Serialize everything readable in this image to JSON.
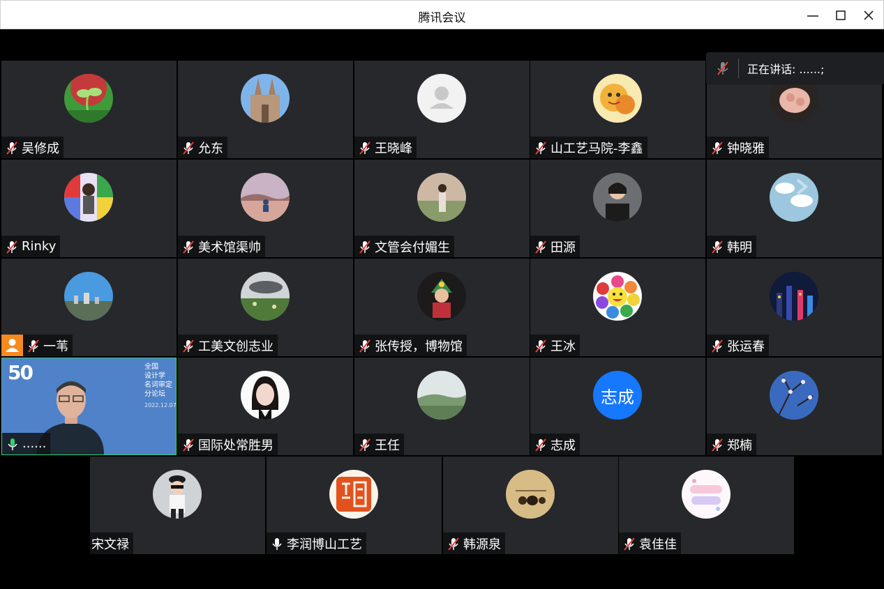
{
  "window": {
    "title": "腾讯会议"
  },
  "speaking": {
    "label": "正在讲话: ......;"
  },
  "participants": [
    {
      "name": "吴修成",
      "mic": "muted"
    },
    {
      "name": "允东",
      "mic": "muted"
    },
    {
      "name": "王晓峰",
      "mic": "muted"
    },
    {
      "name": "山工艺马院-李鑫",
      "mic": "muted"
    },
    {
      "name": "钟晓雅",
      "mic": "muted"
    },
    {
      "name": "Rinky",
      "mic": "muted"
    },
    {
      "name": "美术馆渠帅",
      "mic": "muted"
    },
    {
      "name": "文管会付媚生",
      "mic": "muted"
    },
    {
      "name": "田源",
      "mic": "muted"
    },
    {
      "name": "韩明",
      "mic": "muted"
    },
    {
      "name": "一苇",
      "mic": "muted",
      "host": true
    },
    {
      "name": "工美文创志业",
      "mic": "muted"
    },
    {
      "name": "张传授，博物馆",
      "mic": "muted"
    },
    {
      "name": "王冰",
      "mic": "muted"
    },
    {
      "name": "张运春",
      "mic": "muted"
    },
    {
      "name": "......",
      "mic": "active",
      "video": true
    },
    {
      "name": "国际处常胜男",
      "mic": "muted"
    },
    {
      "name": "王任",
      "mic": "muted"
    },
    {
      "name": "志成",
      "mic": "muted",
      "avatar_text": "志成"
    },
    {
      "name": "郑楠",
      "mic": "muted"
    },
    {
      "name": "宋文禄",
      "mic": "none"
    },
    {
      "name": "李润博山工艺",
      "mic": "on"
    },
    {
      "name": "韩源泉",
      "mic": "muted"
    },
    {
      "name": "袁佳佳",
      "mic": "muted"
    }
  ],
  "video_overlay": {
    "logo": "50",
    "lines": [
      "全国",
      "设计学",
      "名词审定",
      "分论坛"
    ],
    "date": "2022.12.07"
  },
  "colors": {
    "tile_bg": "#26282c",
    "nametag_bg": "#121315",
    "host_badge": "#f58a1f",
    "active_mic": "#2fd46d",
    "avatar_blue": "#1677ff"
  }
}
